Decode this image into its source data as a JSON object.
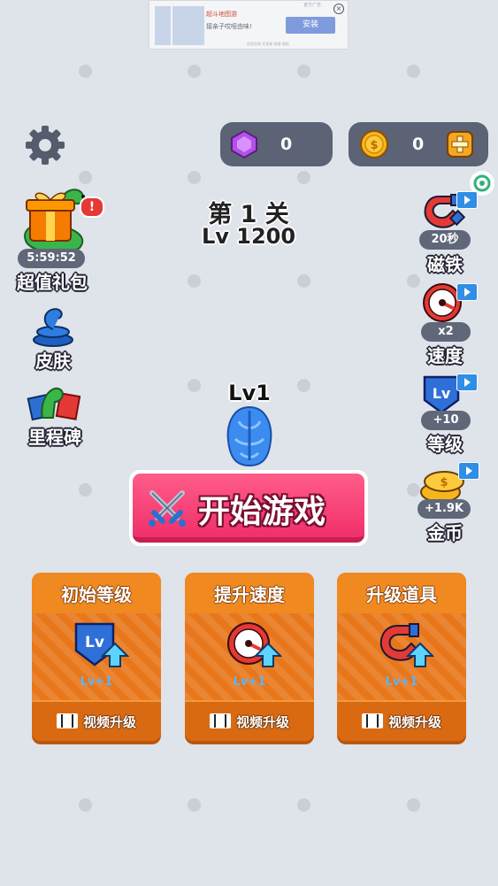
{
  "ad": {
    "title": "超斗地图游",
    "subtitle": "接亲子哎哑由味!",
    "tag": "官方广告",
    "install_label": "安装",
    "fine_print": "应用名称 开发者 权限 隐私"
  },
  "currency": {
    "gems": "0",
    "coins": "0"
  },
  "level": {
    "stage": "第 1 关",
    "lv": "Lv 1200"
  },
  "left_menu": {
    "gift": {
      "timer": "5:59:52",
      "label": "超值礼包"
    },
    "skin": {
      "label": "皮肤"
    },
    "milestone": {
      "label": "里程碑"
    }
  },
  "right_menu": {
    "magnet": {
      "value": "20秒",
      "label": "磁铁"
    },
    "speed": {
      "value": "x2",
      "label": "速度"
    },
    "level": {
      "value": "+10",
      "label": "等级",
      "icon_text": "Lv"
    },
    "coins": {
      "value": "+1.9K",
      "label": "金币"
    }
  },
  "player": {
    "level_label": "Lv1"
  },
  "start_button": {
    "label": "开始游戏"
  },
  "upgrades": [
    {
      "title": "初始等级",
      "level": "Lv+1",
      "action": "视频升级",
      "icon_text": "Lv"
    },
    {
      "title": "提升速度",
      "level": "Lv+1",
      "action": "视频升级"
    },
    {
      "title": "升级道具",
      "level": "Lv+1",
      "action": "视频升级"
    }
  ],
  "colors": {
    "background": "#dfe3ea",
    "start_button": "#f0306b",
    "card": "#e8771c",
    "pill": "#5b6375"
  }
}
